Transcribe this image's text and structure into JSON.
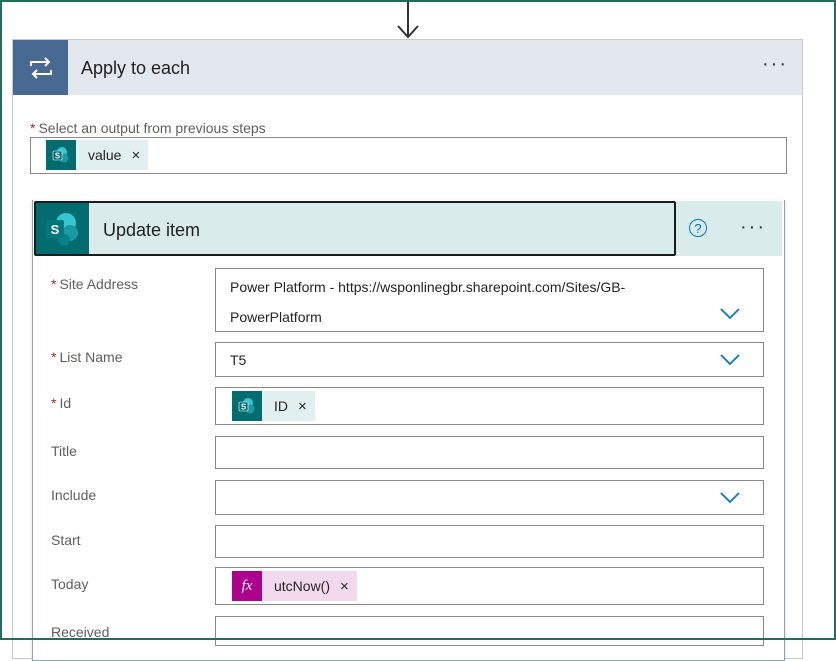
{
  "apply_each": {
    "title": "Apply to each",
    "more_label": "···",
    "output_label": "Select an output from previous steps",
    "output_token": "value",
    "token_remove": "×"
  },
  "update_item": {
    "title": "Update item",
    "help_label": "?",
    "more_label": "···",
    "fields": {
      "site_address": {
        "label": "Site Address",
        "value_line1": "Power Platform - https://wsponlinegbr.sharepoint.com/Sites/GB-",
        "value_line2": "PowerPlatform"
      },
      "list_name": {
        "label": "List Name",
        "value": "T5"
      },
      "id": {
        "label": "Id",
        "token": "ID"
      },
      "title": {
        "label": "Title"
      },
      "include": {
        "label": "Include"
      },
      "start": {
        "label": "Start"
      },
      "today": {
        "label": "Today",
        "token": "utcNow()",
        "fx_icon": "fx"
      },
      "received": {
        "label": "Received"
      }
    },
    "required_marker": "*",
    "token_remove": "×"
  },
  "colors": {
    "loop_header": "#486991",
    "sharepoint": "#036c70",
    "expression": "#ad008c",
    "accent": "#0078d4"
  }
}
